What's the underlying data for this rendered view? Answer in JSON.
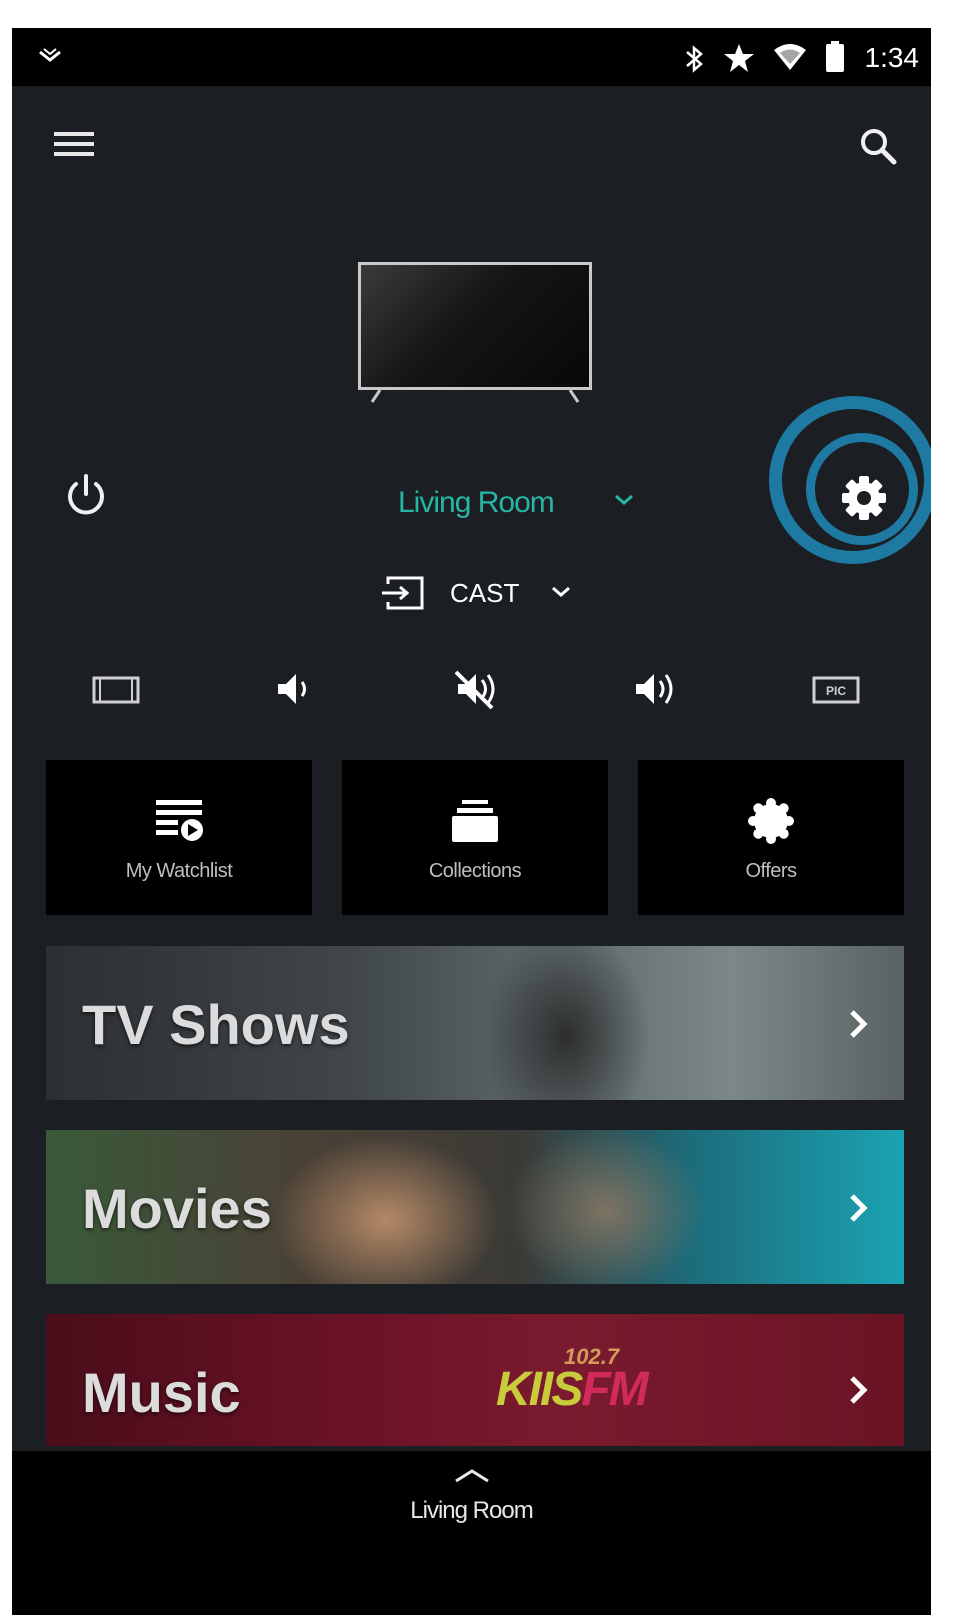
{
  "status_bar": {
    "time": "1:34",
    "icons": [
      "notification-chevron-icon",
      "bluetooth-icon",
      "star-icon",
      "wifi-icon",
      "battery-icon"
    ]
  },
  "app_bar": {
    "menu_icon": "hamburger-menu-icon",
    "search_icon": "search-icon"
  },
  "device": {
    "room": "Living Room",
    "input": "CAST",
    "highlight_color": "#1e7aa2",
    "accent_color": "#27b6a5"
  },
  "controls": [
    {
      "name": "aspect-ratio-icon"
    },
    {
      "name": "volume-down-icon"
    },
    {
      "name": "mute-icon"
    },
    {
      "name": "volume-up-icon"
    },
    {
      "name": "picture-mode-icon",
      "label": "PIC"
    }
  ],
  "tiles": [
    {
      "label": "My Watchlist",
      "icon": "watchlist-icon"
    },
    {
      "label": "Collections",
      "icon": "collections-icon"
    },
    {
      "label": "Offers",
      "icon": "offers-badge-icon"
    }
  ],
  "banners": [
    {
      "title": "TV Shows"
    },
    {
      "title": "Movies"
    },
    {
      "title": "Music",
      "logo_text": "KIIS",
      "logo_text_2": "FM",
      "logo_freq": "102.7"
    }
  ],
  "bottom_bar": {
    "room": "Living Room"
  }
}
